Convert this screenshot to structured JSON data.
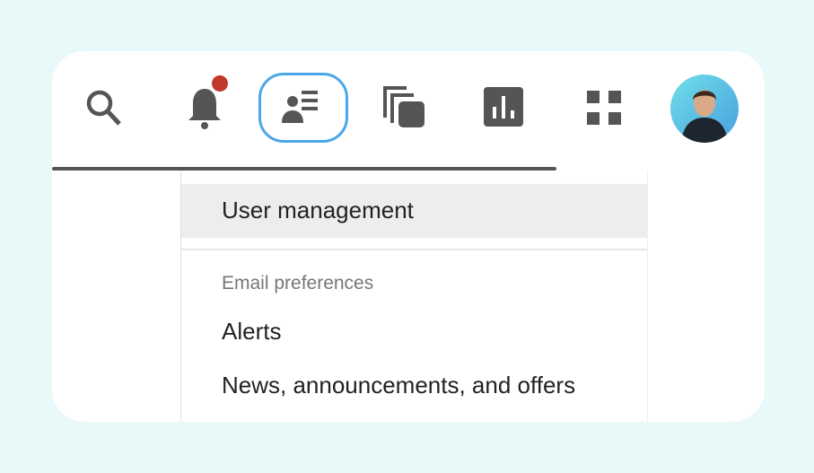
{
  "toolbar": {
    "icons": [
      "search-icon",
      "bell-icon",
      "user-management-icon",
      "copy-icon",
      "chart-icon",
      "apps-grid-icon"
    ],
    "notification_dot_color": "#c0392b",
    "selected_outline_color": "#4aa8e8"
  },
  "menu": {
    "user_management": "User management",
    "section_label": "Email preferences",
    "alerts": "Alerts",
    "news": "News, announcements, and offers"
  }
}
